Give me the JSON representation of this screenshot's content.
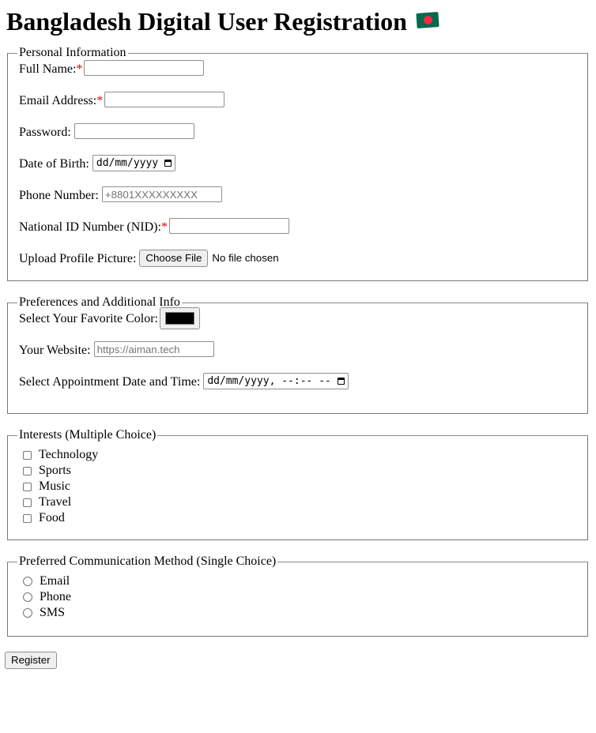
{
  "page": {
    "title": "Bangladesh Digital User Registration",
    "flag_icon": "bangladesh-flag-icon"
  },
  "personal": {
    "legend": "Personal Information",
    "full_name_label": "Full Name:",
    "email_label": "Email Address:",
    "password_label": "Password:",
    "dob_label": "Date of Birth:",
    "dob_value": "dd/mm/yyyy",
    "phone_label": "Phone Number:",
    "phone_placeholder": "+8801XXXXXXXXX",
    "nid_label": "National ID Number (NID):",
    "picture_label": "Upload Profile Picture:",
    "choose_file": "Choose File",
    "no_file": "No file chosen",
    "required_mark": "*"
  },
  "preferences": {
    "legend": "Preferences and Additional Info",
    "color_label": "Select Your Favorite Color:",
    "color_value": "#000000",
    "website_label": "Your Website:",
    "website_placeholder": "https://aiman.tech",
    "appointment_label": "Select Appointment Date and Time:",
    "appointment_value": "dd/mm/yyyy, --:-- --"
  },
  "interests": {
    "legend": "Interests (Multiple Choice)",
    "options": [
      "Technology",
      "Sports",
      "Music",
      "Travel",
      "Food"
    ]
  },
  "communication": {
    "legend": "Preferred Communication Method (Single Choice)",
    "options": [
      "Email",
      "Phone",
      "SMS"
    ]
  },
  "register_button": "Register"
}
